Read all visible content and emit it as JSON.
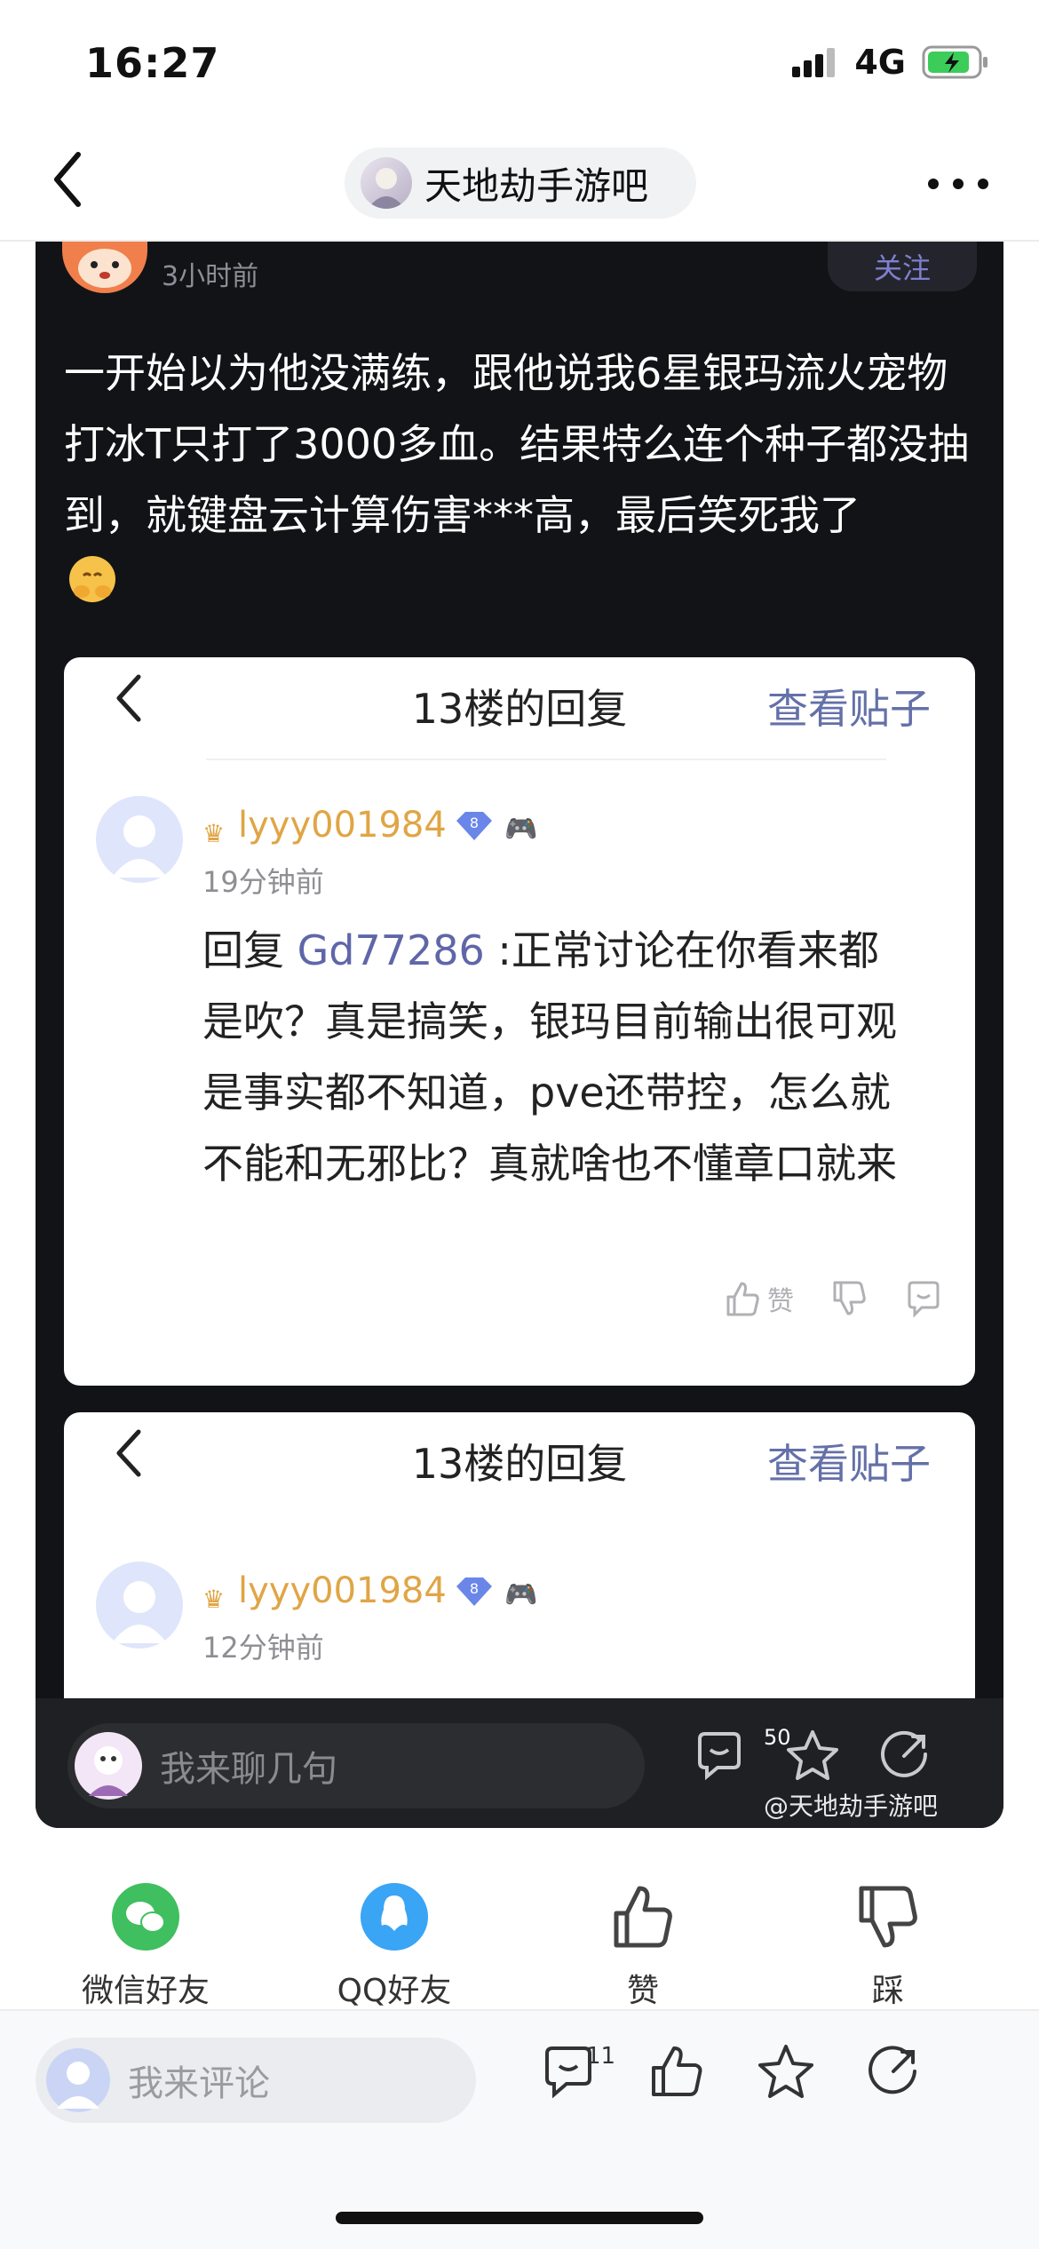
{
  "status": {
    "time": "16:27",
    "network": "4G"
  },
  "nav": {
    "title": "天地劫手游吧"
  },
  "post": {
    "time": "3小时前",
    "follow_label": "关注",
    "text": "一开始以为他没满练，跟他说我6星银玛流火宠物打冰T只打了3000多血。结果特么连个种子都没抽到，就键盘云计算伤害***高，最后笑死我了"
  },
  "cards": [
    {
      "title": "13楼的回复",
      "link": "查看贴子",
      "username": "lyyy001984",
      "level": "8",
      "time": "19分钟前",
      "reply_prefix": "回复 ",
      "mention": "Gd77286",
      "reply_text": " :正常讨论在你看来都是吹？真是搞笑，银玛目前输出很可观是事实都不知道，pve还带控，怎么就不能和无邪比？真就啥也不懂章口就来",
      "like_label": "赞"
    },
    {
      "title": "13楼的回复",
      "link": "查看贴子",
      "username": "lyyy001984",
      "level": "8",
      "time": "12分钟前"
    }
  ],
  "dark_bar": {
    "placeholder": "我来聊几句",
    "comment_count": "50",
    "watermark": "@天地劫手游吧"
  },
  "share": {
    "wechat": "微信好友",
    "qq": "QQ好友",
    "like": "赞",
    "dislike": "踩"
  },
  "bottom_bar": {
    "placeholder": "我来评论",
    "comment_count": "11"
  },
  "colors": {
    "accent": "#5f66a8",
    "dark_bg": "#121316",
    "gold": "#e0a545",
    "wechat": "#3fbf5f",
    "qq": "#3aa4f5"
  }
}
